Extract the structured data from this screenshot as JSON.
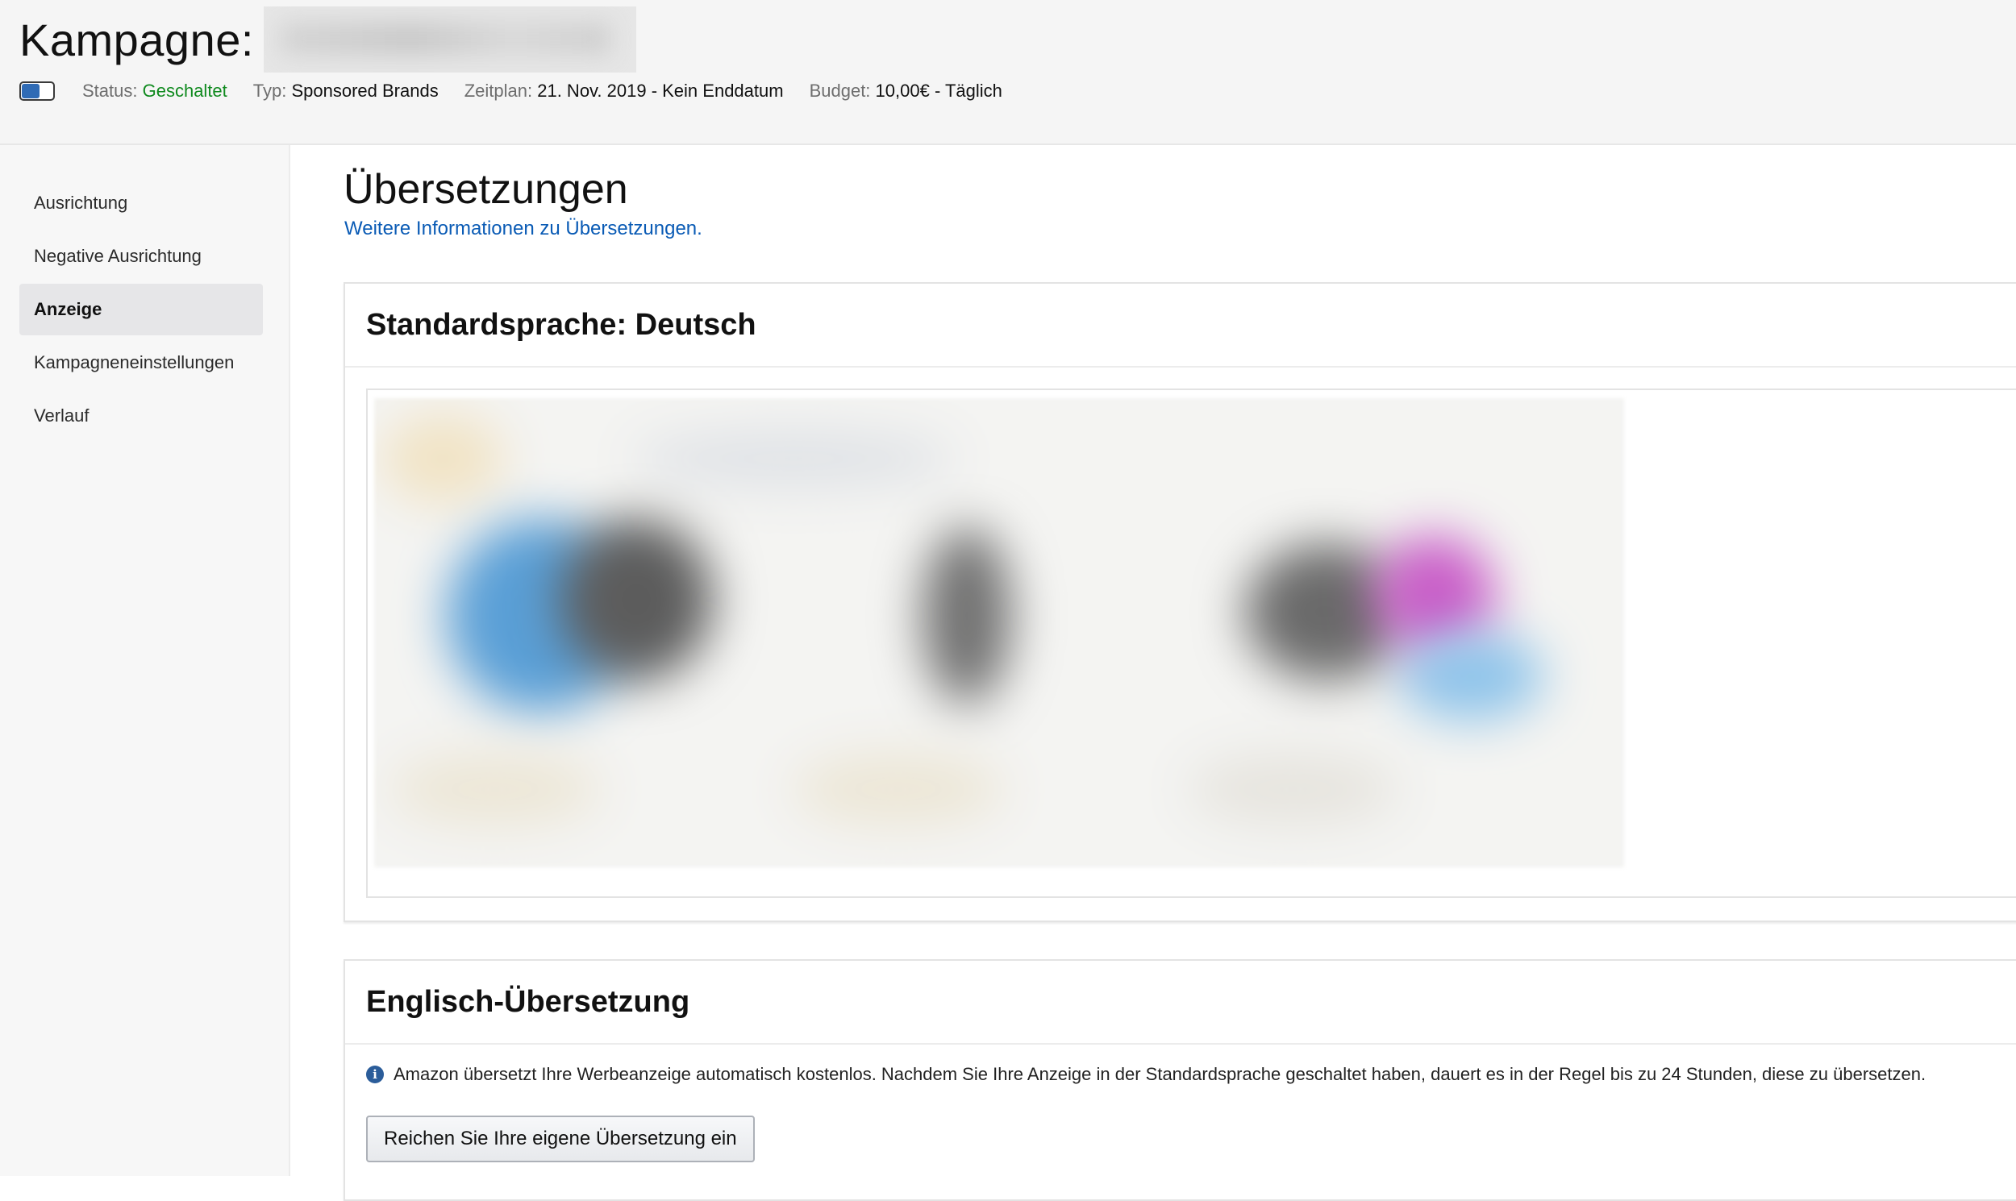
{
  "header": {
    "campaign_label": "Kampagne:",
    "status_key": "Status:",
    "status_value": "Geschaltet",
    "type_key": "Typ:",
    "type_value": "Sponsored Brands",
    "schedule_key": "Zeitplan:",
    "schedule_value": "21. Nov. 2019 - Kein Enddatum",
    "budget_key": "Budget:",
    "budget_value": "10,00€ - Täglich",
    "toggle_on": true
  },
  "sidebar": {
    "items": [
      {
        "label": "Ausrichtung",
        "active": false
      },
      {
        "label": "Negative Ausrichtung",
        "active": false
      },
      {
        "label": "Anzeige",
        "active": true
      },
      {
        "label": "Kampagneneinstellungen",
        "active": false
      },
      {
        "label": "Verlauf",
        "active": false
      }
    ]
  },
  "main": {
    "title": "Übersetzungen",
    "info_link": "Weitere Informationen zu Übersetzungen.",
    "default_card": {
      "title": "Standardsprache: Deutsch"
    },
    "english_card": {
      "title": "Englisch-Übersetzung",
      "notice": "Amazon übersetzt Ihre Werbeanzeige automatisch kostenlos. Nachdem Sie Ihre Anzeige in der Standardsprache geschaltet haben, dauert es in der Regel bis zu 24 Stunden, diese zu übersetzen.",
      "submit_label": "Reichen Sie Ihre eigene Übersetzung ein"
    }
  },
  "colors": {
    "status_green": "#108a1f",
    "link_blue": "#0a5bb5",
    "toggle_blue": "#2f6bb5",
    "sidebar_active_bg": "#e6e6e8"
  },
  "icons": {
    "info": "info-icon",
    "toggle": "toggle-switch"
  }
}
